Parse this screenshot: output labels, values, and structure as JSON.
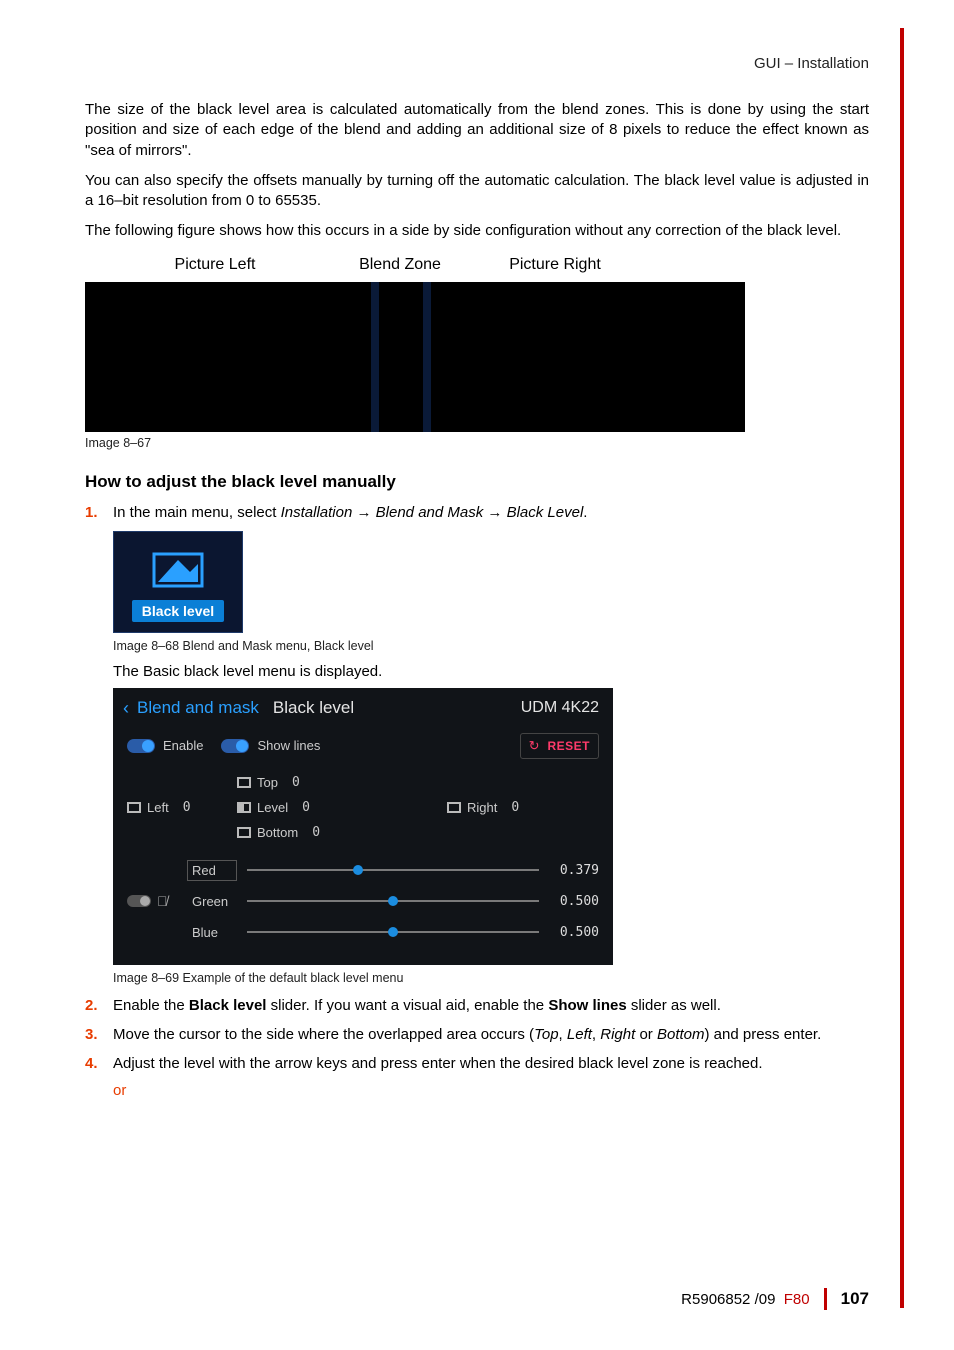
{
  "header": {
    "section": "GUI – Installation"
  },
  "paragraphs": {
    "p1": "The size of the black level area is calculated automatically from the blend zones. This is done by using the start position and size of each edge of the blend and adding an additional size of 8 pixels to reduce the effect known as \"sea of mirrors\".",
    "p2": "You can also specify the offsets manually by turning off the automatic calculation. The black level value is adjusted in a 16–bit resolution from 0 to 65535.",
    "p3": "The following figure shows how this occurs in a side by side configuration without any correction of the black level."
  },
  "diagram_labels": {
    "left": "Picture Left",
    "mid": "Blend Zone",
    "right": "Picture Right"
  },
  "captions": {
    "c1": "Image 8–67",
    "c2": "Image 8–68  Blend and Mask menu, Black level",
    "c3": "Image 8–69  Example of the default black level menu"
  },
  "heading": "How to adjust the black level manually",
  "steps": {
    "s1_lead": "In the main menu, select ",
    "s1_path1": "Installation",
    "s1_arrow": " → ",
    "s1_path2": "Blend and Mask",
    "s1_path3": "Black Level",
    "s1_end": ".",
    "basic_line": "The Basic black level menu is displayed.",
    "s2a": "Enable the ",
    "s2b": "Black level",
    "s2c": " slider. If you want a visual aid, enable the ",
    "s2d": "Show lines",
    "s2e": " slider as well.",
    "s3a": "Move the cursor to the side where the overlapped area occurs (",
    "s3_top": "Top",
    "s3_comma": ", ",
    "s3_left": "Left",
    "s3_right": "Right",
    "s3_or": " or ",
    "s3_bottom": "Bottom",
    "s3b": ") and press enter.",
    "s4": "Adjust the level with the arrow keys and press enter when the desired black level zone is reached.",
    "or": "or",
    "n1": "1.",
    "n2": "2.",
    "n3": "3.",
    "n4": "4."
  },
  "tile": {
    "label": "Black level"
  },
  "menu": {
    "back": "‹",
    "breadcrumb": "Blend and mask",
    "title": "Black level",
    "device": "UDM 4K22",
    "enable": "Enable",
    "showlines": "Show lines",
    "reset": "RESET",
    "top": "Top",
    "left": "Left",
    "level": "Level",
    "right": "Right",
    "bottom": "Bottom",
    "zero": "0",
    "sliders": {
      "red": {
        "name": "Red",
        "value": "0.379",
        "pct": 37.9
      },
      "green": {
        "name": "Green",
        "value": "0.500",
        "pct": 50
      },
      "blue": {
        "name": "Blue",
        "value": "0.500",
        "pct": 50
      }
    }
  },
  "footer": {
    "docnum": "R5906852 /09",
    "model": "F80",
    "page": "107"
  }
}
